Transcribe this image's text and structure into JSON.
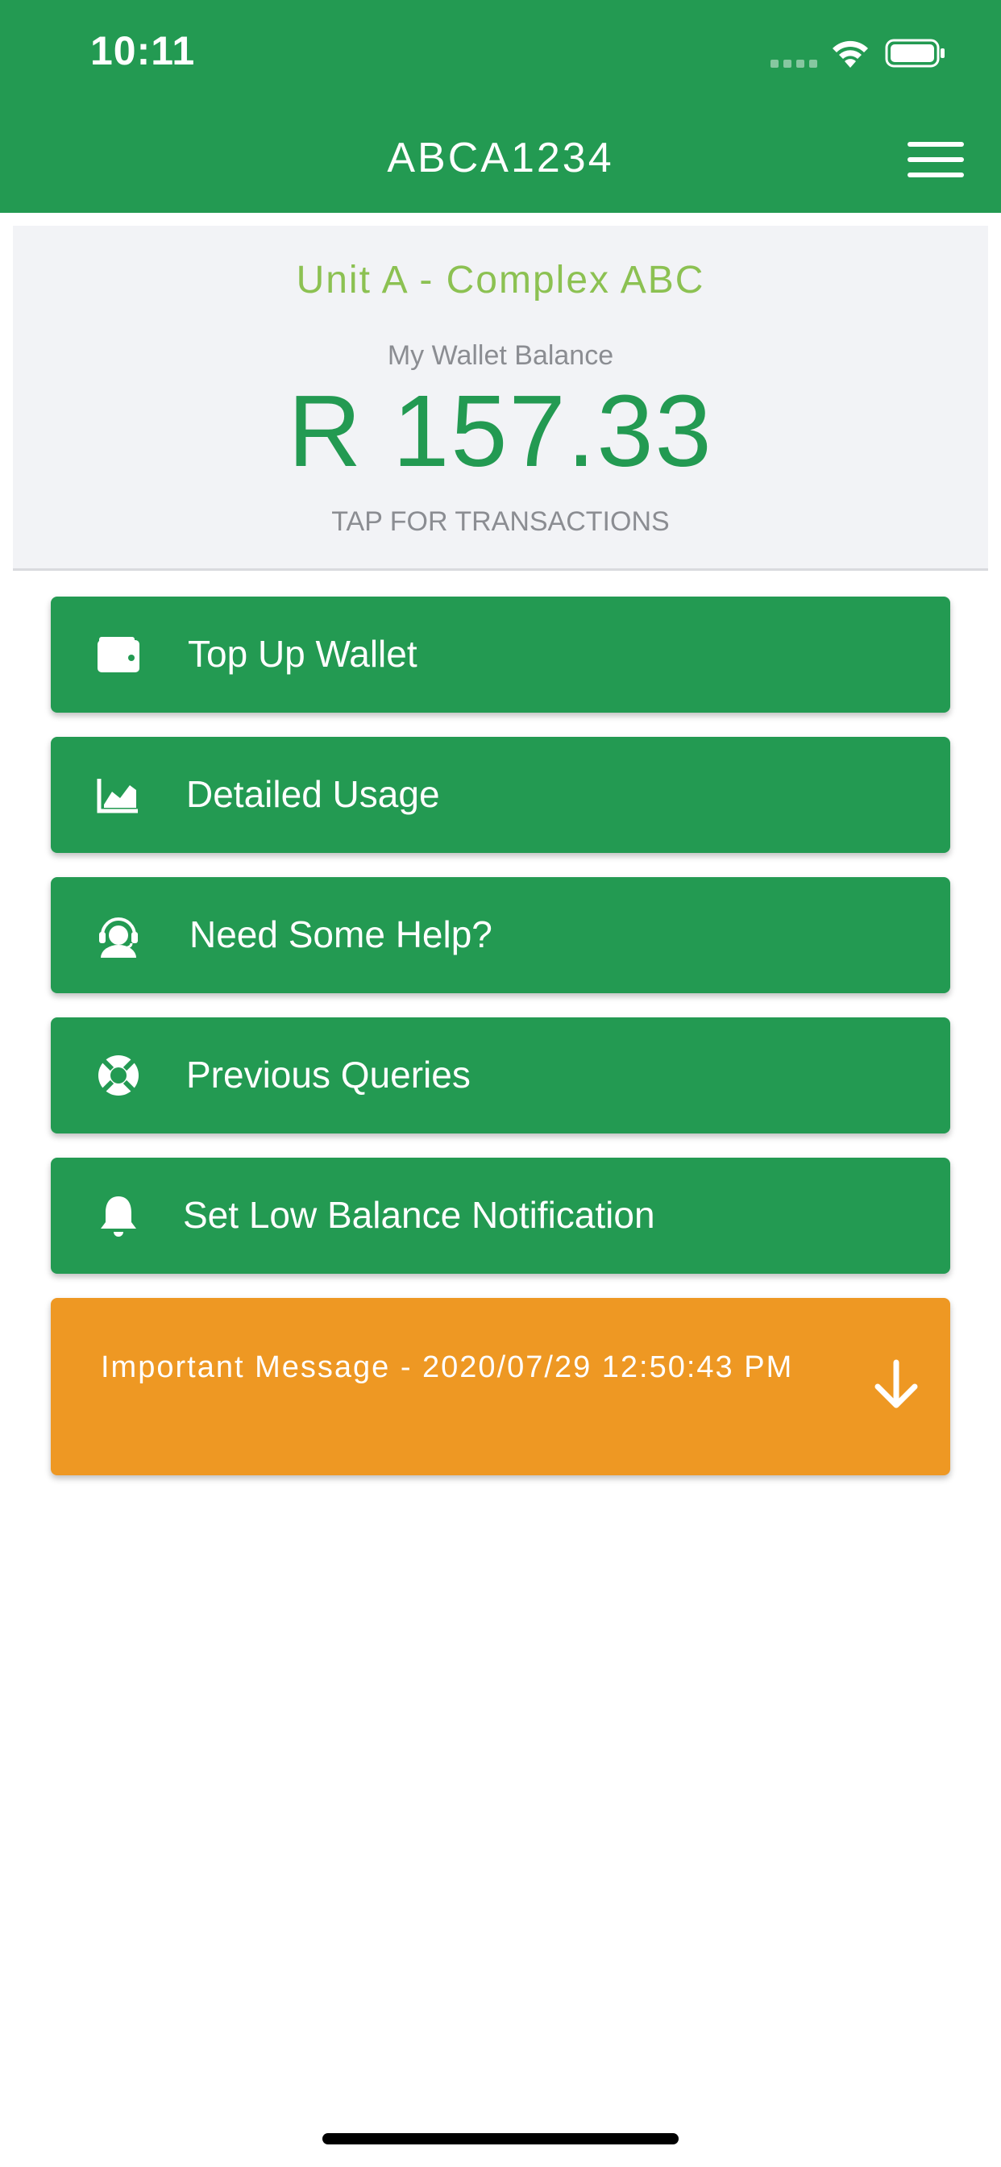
{
  "status_bar": {
    "time": "10:11"
  },
  "header": {
    "title": "ABCA1234",
    "menu_icon": "hamburger-menu-icon"
  },
  "wallet": {
    "unit_name": "Unit A - Complex ABC",
    "balance_label": "My Wallet Balance",
    "balance": "R 157.33",
    "tap_hint": "TAP FOR TRANSACTIONS"
  },
  "actions": [
    {
      "label": "Top Up Wallet",
      "icon": "wallet-icon"
    },
    {
      "label": "Detailed Usage",
      "icon": "chart-icon"
    },
    {
      "label": "Need Some Help?",
      "icon": "support-agent-icon"
    },
    {
      "label": "Previous Queries",
      "icon": "lifebuoy-icon"
    },
    {
      "label": "Set Low Balance Notification",
      "icon": "bell-icon"
    }
  ],
  "message_banner": {
    "text": "Important Message - 2020/07/29 12:50:43 PM",
    "icon": "arrow-down-icon"
  },
  "colors": {
    "brand_green": "#239a52",
    "unit_green": "#8cc152",
    "message_orange": "#ee9823",
    "card_background": "#f2f3f6",
    "muted_text": "#8b8d92"
  }
}
